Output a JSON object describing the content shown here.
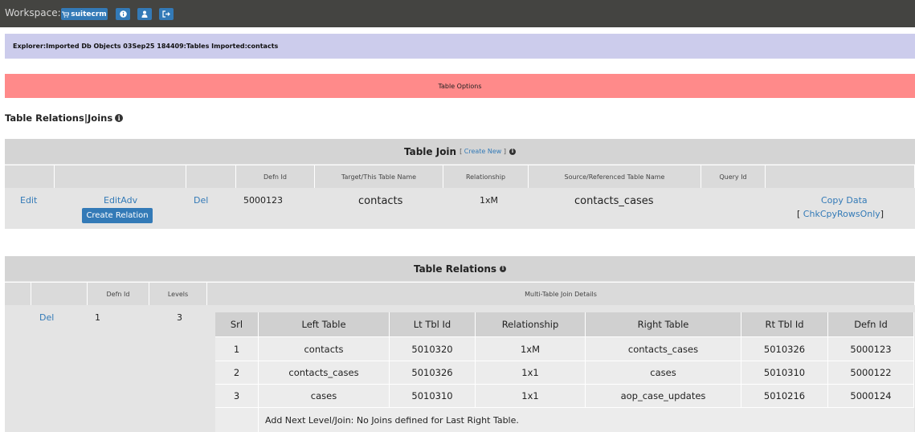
{
  "topbar": {
    "workspace_label": "Workspace:",
    "app_button_label": "suitecrm",
    "accent": "#337ab7"
  },
  "explorer": {
    "path": "Explorer:Imported Db Objects 03Sep25 184409:Tables Imported:contacts"
  },
  "options": {
    "label": "Table Options"
  },
  "section": {
    "title": "Table Relations|Joins"
  },
  "join": {
    "title": "Table Join",
    "create_new_open": "[",
    "create_new": "Create New",
    "create_new_close": "]",
    "headers": [
      "Defn Id",
      "Target/This Table Name",
      "Relationship",
      "Source/Referenced Table Name",
      "Query Id"
    ],
    "row": {
      "edit": "Edit",
      "edit_adv": "EditAdv",
      "create_relation": "Create Relation",
      "del": "Del",
      "defn_id": "5000123",
      "target": "contacts",
      "relationship": "1xM",
      "source": "contacts_cases",
      "query_id": "",
      "copy_data": "Copy Data",
      "chk_open": "[",
      "chk": "ChkCpyRowsOnly",
      "chk_close": "]"
    }
  },
  "relations": {
    "title": "Table Relations",
    "headers": [
      "Defn Id",
      "Levels",
      "Multi-Table Join Details"
    ],
    "row": {
      "del": "Del",
      "defn_id": "1",
      "levels": "3"
    },
    "inner_headers": [
      "Srl",
      "Left Table",
      "Lt Tbl Id",
      "Relationship",
      "Right Table",
      "Rt Tbl Id",
      "Defn Id"
    ],
    "inner_rows": [
      [
        "1",
        "contacts",
        "5010320",
        "1xM",
        "contacts_cases",
        "5010326",
        "5000123"
      ],
      [
        "2",
        "contacts_cases",
        "5010326",
        "1x1",
        "cases",
        "5010310",
        "5000122"
      ],
      [
        "3",
        "cases",
        "5010310",
        "1x1",
        "aop_case_updates",
        "5010216",
        "5000124"
      ]
    ],
    "footer": "Add Next Level/Join: No Joins defined for Last Right Table."
  }
}
